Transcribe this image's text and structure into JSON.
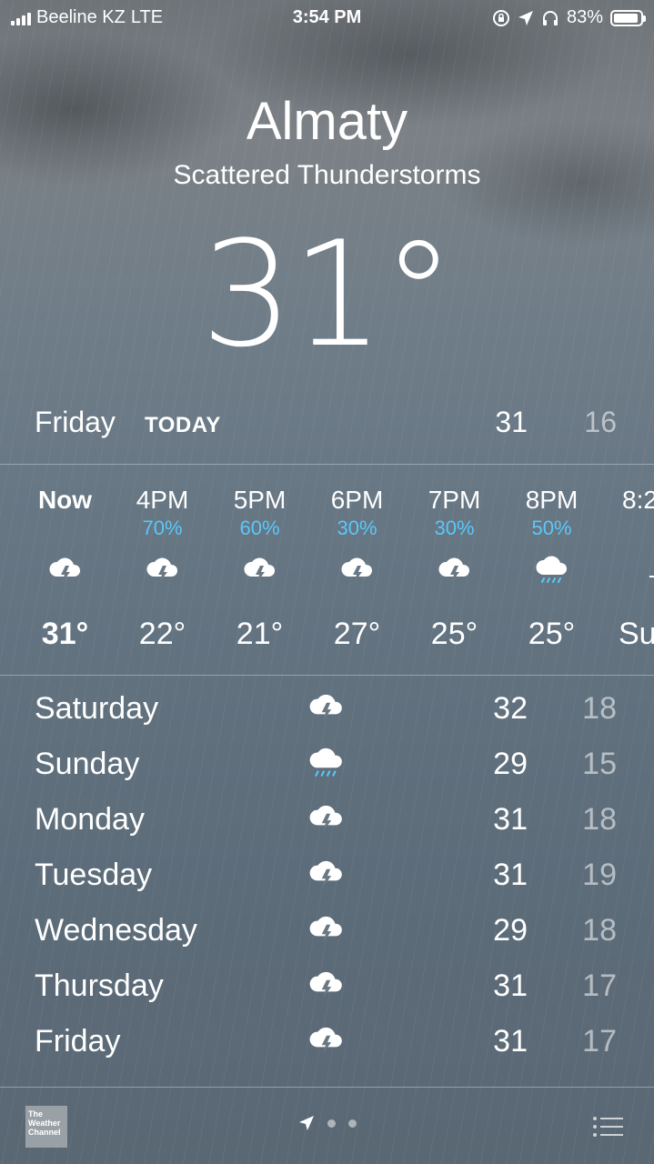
{
  "status_bar": {
    "carrier": "Beeline KZ",
    "network": "LTE",
    "time": "3:54 PM",
    "battery": "83%",
    "battery_level": 0.83
  },
  "location": {
    "city": "Almaty",
    "condition": "Scattered Thunderstorms",
    "temperature": "31°"
  },
  "today": {
    "day": "Friday",
    "label": "TODAY",
    "high": "31",
    "low": "16"
  },
  "hourly": [
    {
      "time": "Now",
      "pop": "",
      "icon": "thunderstorm-icon",
      "temp": "31°"
    },
    {
      "time": "4PM",
      "pop": "70%",
      "icon": "thunderstorm-icon",
      "temp": "22°"
    },
    {
      "time": "5PM",
      "pop": "60%",
      "icon": "thunderstorm-icon",
      "temp": "21°"
    },
    {
      "time": "6PM",
      "pop": "30%",
      "icon": "thunderstorm-icon",
      "temp": "27°"
    },
    {
      "time": "7PM",
      "pop": "30%",
      "icon": "thunderstorm-icon",
      "temp": "25°"
    },
    {
      "time": "8PM",
      "pop": "50%",
      "icon": "rain-icon",
      "temp": "25°"
    },
    {
      "time": "8:2",
      "pop": "",
      "icon": "sunset-icon",
      "temp": "Su"
    }
  ],
  "daily": [
    {
      "day": "Saturday",
      "icon": "thunderstorm-icon",
      "high": "32",
      "low": "18"
    },
    {
      "day": "Sunday",
      "icon": "rain-icon",
      "high": "29",
      "low": "15"
    },
    {
      "day": "Monday",
      "icon": "thunderstorm-icon",
      "high": "31",
      "low": "18"
    },
    {
      "day": "Tuesday",
      "icon": "thunderstorm-icon",
      "high": "31",
      "low": "19"
    },
    {
      "day": "Wednesday",
      "icon": "thunderstorm-icon",
      "high": "29",
      "low": "18"
    },
    {
      "day": "Thursday",
      "icon": "thunderstorm-icon",
      "high": "31",
      "low": "17"
    },
    {
      "day": "Friday",
      "icon": "thunderstorm-icon",
      "high": "31",
      "low": "17"
    }
  ],
  "bottom_bar": {
    "logo_text": "The Weather Channel",
    "pages": 2
  },
  "colors": {
    "precip": "#5ac8fa",
    "low_temp": "rgba(255,255,255,0.55)"
  }
}
